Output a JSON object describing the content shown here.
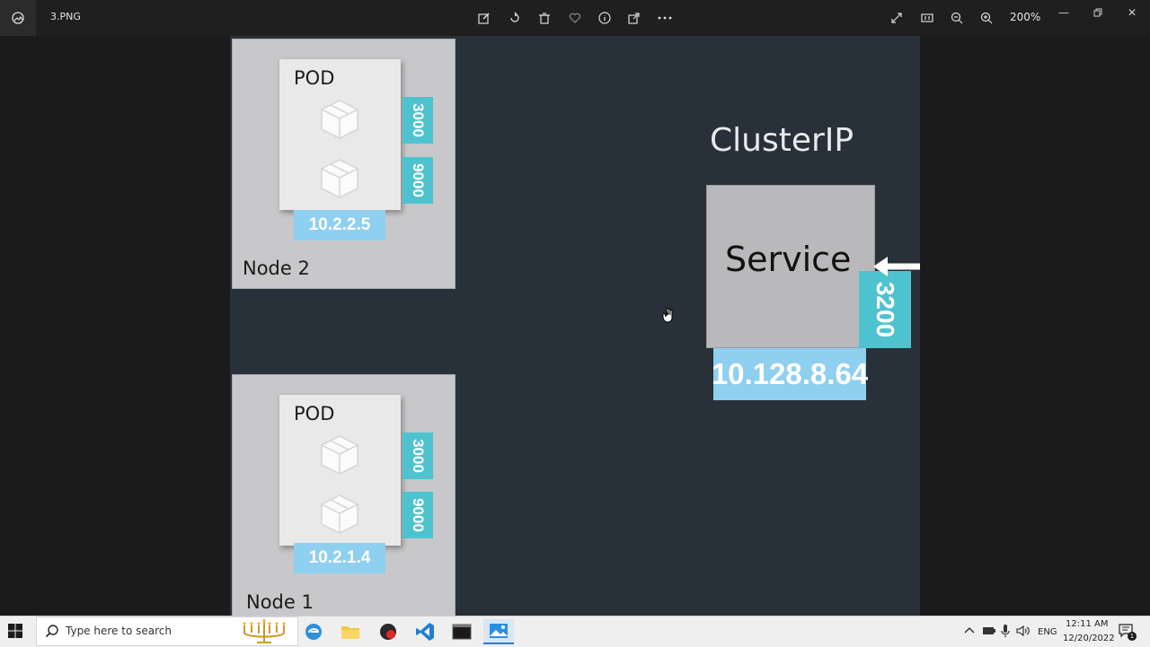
{
  "window": {
    "file_name": "3.PNG",
    "zoom_level": "200%"
  },
  "toolbar": {
    "icons": [
      "edit-image-icon",
      "rotate-icon",
      "delete-icon",
      "favorite-icon",
      "info-icon",
      "share-icon",
      "more-icon"
    ],
    "right_icons": [
      "fullscreen-icon",
      "actual-size-icon",
      "zoom-out-icon",
      "zoom-in-icon"
    ]
  },
  "diagram": {
    "title": "ClusterIP",
    "service": {
      "label": "Service",
      "port": "3200",
      "ip": "10.128.8.64"
    },
    "nodes": [
      {
        "label": "Node 2",
        "pod_label": "POD",
        "ports": [
          "3000",
          "9000"
        ],
        "ip": "10.2.2.5"
      },
      {
        "label": "Node 1",
        "pod_label": "POD",
        "ports": [
          "3000",
          "9000"
        ],
        "ip": "10.2.1.4"
      }
    ]
  },
  "taskbar": {
    "search_placeholder": "Type here to search",
    "language": "ENG",
    "time": "12:11 AM",
    "date": "12/20/2022",
    "notification_count": "1"
  },
  "colors": {
    "canvas_bg": "#283039",
    "port_teal": "#4fc2cf",
    "ip_blue": "#8fcff0",
    "node_gray": "#c8c8ca"
  }
}
